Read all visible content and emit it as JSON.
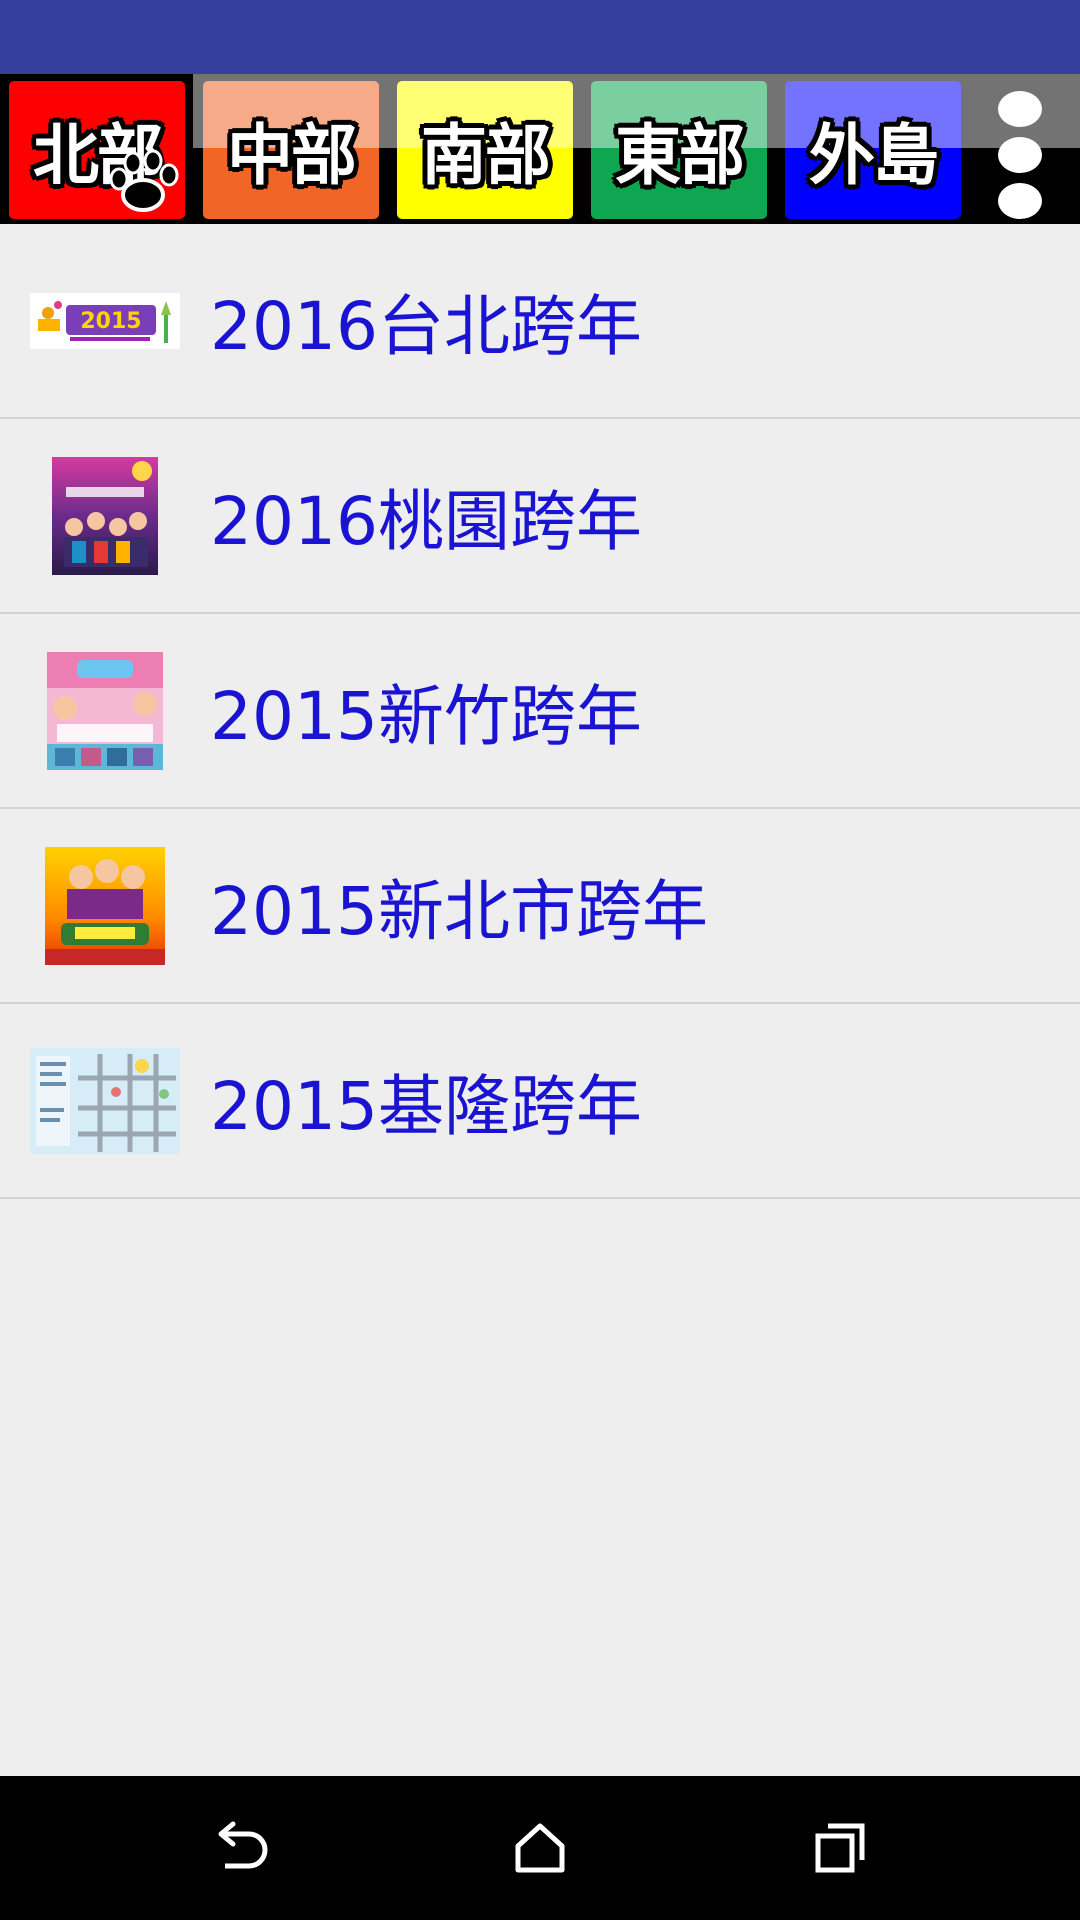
{
  "status_bar": {
    "color": "#34409c"
  },
  "region_tabs": [
    {
      "label": "北部",
      "color": "#ff0000",
      "selected": true,
      "icon": "paw-icon"
    },
    {
      "label": "中部",
      "color": "#f16526"
    },
    {
      "label": "南部",
      "color": "#ffff00"
    },
    {
      "label": "東部",
      "color": "#0ea650"
    },
    {
      "label": "外島",
      "color": "#0000ff"
    }
  ],
  "more_menu": {
    "icon": "more-vertical-icon"
  },
  "events": [
    {
      "title": "2016台北跨年",
      "thumbnail": "taipei-countdown-2015-banner"
    },
    {
      "title": "2016桃園跨年",
      "thumbnail": "taoyuan-countdown-poster"
    },
    {
      "title": "2015新竹跨年",
      "thumbnail": "hsinchu-countdown-flyer"
    },
    {
      "title": "2015新北市跨年",
      "thumbnail": "new-taipei-countdown-poster"
    },
    {
      "title": "2015基隆跨年",
      "thumbnail": "keelung-countdown-map"
    }
  ],
  "thumbnail_text": {
    "taipei_year": "2015"
  },
  "nav_bar": {
    "back": "back-icon",
    "home": "home-icon",
    "recents": "recents-icon"
  },
  "colors": {
    "list_background": "#eeeeee",
    "title_text": "#1a14d2",
    "divider": "#d2d2d2"
  }
}
